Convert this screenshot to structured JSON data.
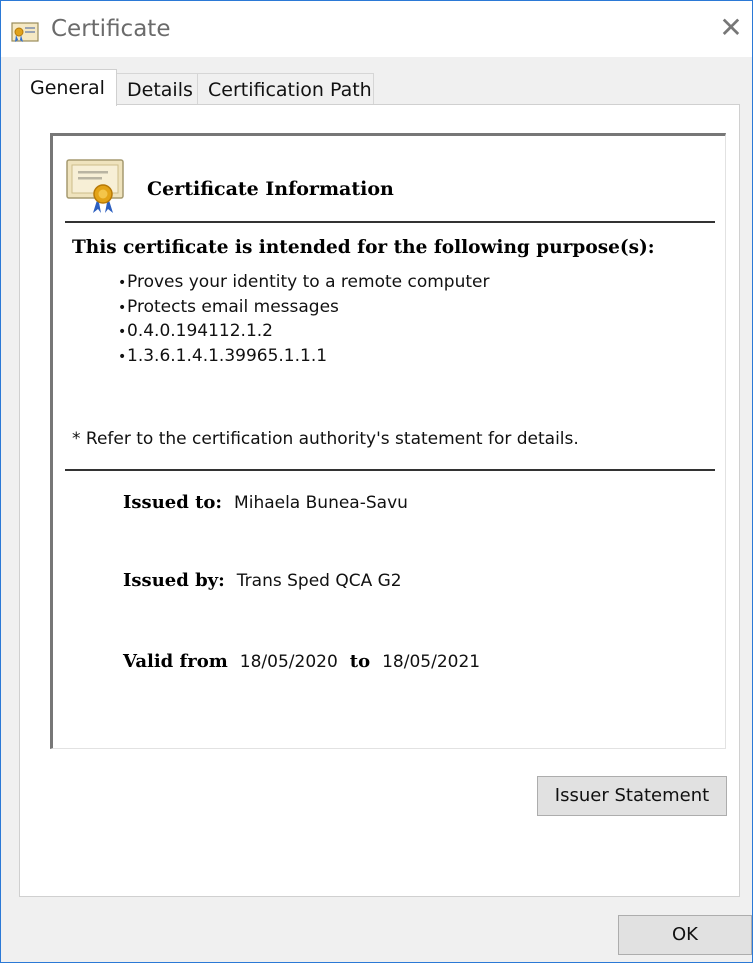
{
  "window": {
    "title": "Certificate",
    "close_glyph": "✕",
    "title_icon": "certificate-icon"
  },
  "tabs": [
    {
      "label": "General",
      "active": true
    },
    {
      "label": "Details",
      "active": false
    },
    {
      "label": "Certification Path",
      "active": false
    }
  ],
  "info": {
    "icon": "certificate-ribbon-icon",
    "title": "Certificate Information",
    "purpose_heading": "This certificate is intended for the following purpose(s):",
    "purposes": [
      "Proves your identity to a remote computer",
      "Protects email messages",
      "0.4.0.194112.1.2",
      "1.3.6.1.4.1.39965.1.1.1"
    ],
    "note": "* Refer to the certification authority's statement for details.",
    "issued_to_label": "Issued to:",
    "issued_to": "Mihaela Bunea-Savu",
    "issued_by_label": "Issued by:",
    "issued_by": "Trans Sped QCA G2",
    "valid_from_label": "Valid from",
    "valid_from": "18/05/2020",
    "valid_to_label": "to",
    "valid_to": "18/05/2021"
  },
  "buttons": {
    "issuer_statement": "Issuer Statement",
    "ok": "OK"
  }
}
